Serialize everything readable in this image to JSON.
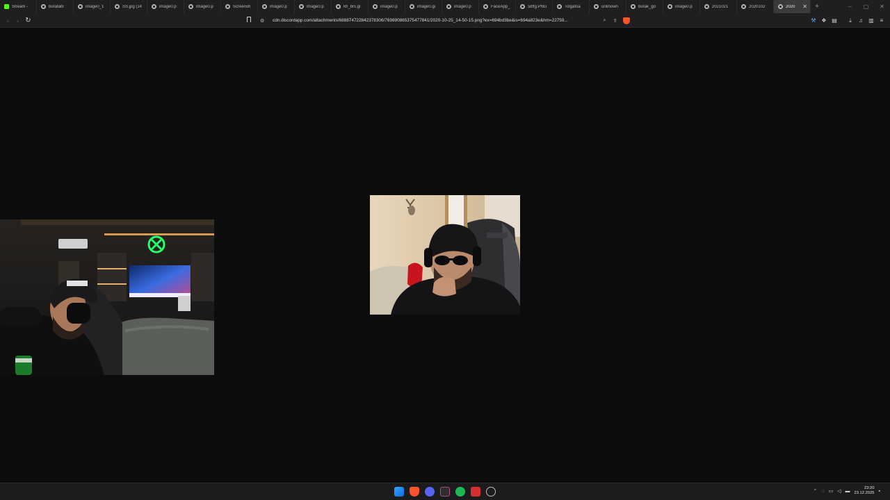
{
  "tabs": [
    {
      "label": "Stream - ",
      "favicon": "kick-icon"
    },
    {
      "label": "buratabi",
      "favicon": "globe-icon"
    },
    {
      "label": "image0_1",
      "favicon": "globe-icon"
    },
    {
      "label": "SS.jpg (14",
      "favicon": "globe-icon"
    },
    {
      "label": "image0.p",
      "favicon": "globe-icon"
    },
    {
      "label": "image0.p",
      "favicon": "globe-icon"
    },
    {
      "label": "Screensh",
      "favicon": "globe-icon"
    },
    {
      "label": "image0.p",
      "favicon": "globe-icon"
    },
    {
      "label": "image0.p",
      "favicon": "globe-icon"
    },
    {
      "label": "kh_brs.gi",
      "favicon": "globe-icon"
    },
    {
      "label": "image0.p",
      "favicon": "globe-icon"
    },
    {
      "label": "image0.gi",
      "favicon": "globe-icon"
    },
    {
      "label": "image0.p",
      "favicon": "globe-icon"
    },
    {
      "label": "FaceApp_",
      "favicon": "globe-icon"
    },
    {
      "label": "sdffg.PNG",
      "favicon": "globe-icon"
    },
    {
      "label": "Tolgafoa",
      "favicon": "globe-icon"
    },
    {
      "label": "unknown",
      "favicon": "globe-icon"
    },
    {
      "label": "burak_go",
      "favicon": "globe-icon"
    },
    {
      "label": "image0.p",
      "favicon": "globe-icon"
    },
    {
      "label": "2021021",
      "favicon": "globe-icon"
    },
    {
      "label": "2020102",
      "favicon": "globe-icon"
    },
    {
      "label": "2020",
      "favicon": "globe-icon",
      "active": true
    }
  ],
  "new_tab": "+",
  "window_controls": {
    "minimize": "–",
    "maximize": "▢",
    "close": "✕"
  },
  "toolbar": {
    "back": "‹",
    "forward": "›",
    "reload": "↻",
    "url": "cdn.discordapp.com/attachments/688874722842378306/769890865375477841/2020-10-25_14-50-15.png?ex=694bd3be&is=694a823e&hm=22759...",
    "zoom_icon": "⌕",
    "share_icon": "⇪",
    "right_icons": [
      "⚒",
      "❖",
      "▤",
      "⤓",
      "♫",
      "▥",
      "≡"
    ]
  },
  "taskbar": {
    "tray_chevron": "⌃",
    "time": "23:20",
    "date": "23.12.2025"
  },
  "colors": {
    "background": "#0c0c0c",
    "chrome": "#1f1f1f",
    "brave_shield": "#fb542b",
    "kick_green": "#53fc18",
    "spotify_green": "#1db954"
  }
}
